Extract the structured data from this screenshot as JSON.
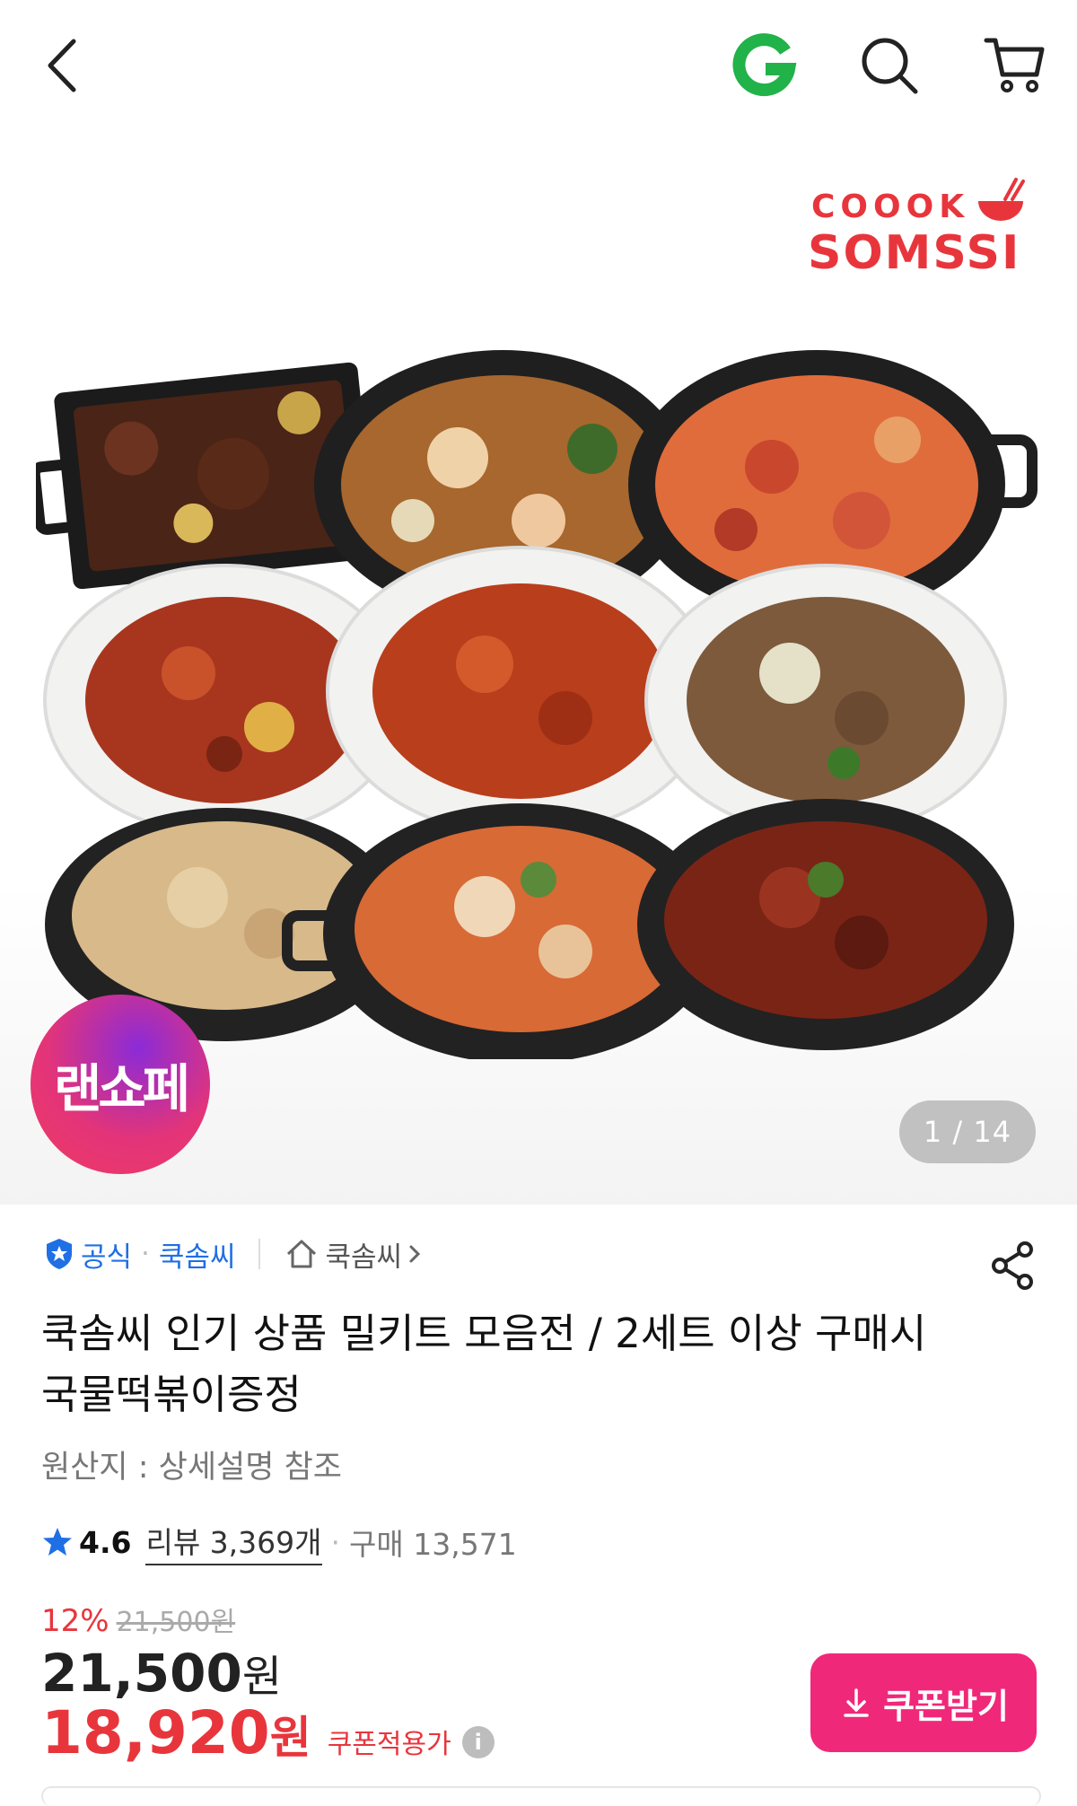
{
  "header": {
    "back_icon": "chevron-left-icon",
    "brand_icon": "gmarket-g-icon",
    "search_icon": "search-icon",
    "cart_icon": "cart-icon"
  },
  "hero": {
    "logo_top": "COOOK",
    "logo_bottom": "SOMSSI",
    "live_badge": "랜쇼페",
    "counter": "1 / 14"
  },
  "store": {
    "official": "공식",
    "brand": "쿡솜씨",
    "shop_link": "쿡솜씨",
    "share_icon": "share-icon"
  },
  "product": {
    "title": "쿡솜씨 인기 상품 밀키트 모음전 / 2세트 이상 구매시 국물떡볶이증정",
    "origin": "원산지 : 상세설명 참조",
    "rating": "4.6",
    "reviews": "리뷰 3,369개",
    "purchases": "구매 13,571"
  },
  "pricing": {
    "discount_pct": "12%",
    "original_price": "21,500원",
    "price_value": "21,500",
    "price_unit": "원",
    "coupon_price_value": "18,920",
    "coupon_price_unit": "원",
    "coupon_label": "쿠폰적용가",
    "coupon_button": "쿠폰받기"
  },
  "colors": {
    "accent_red": "#e8353c",
    "coupon_pink": "#f0287a",
    "official_blue": "#1f6fe5",
    "g_green": "#21b24a"
  }
}
